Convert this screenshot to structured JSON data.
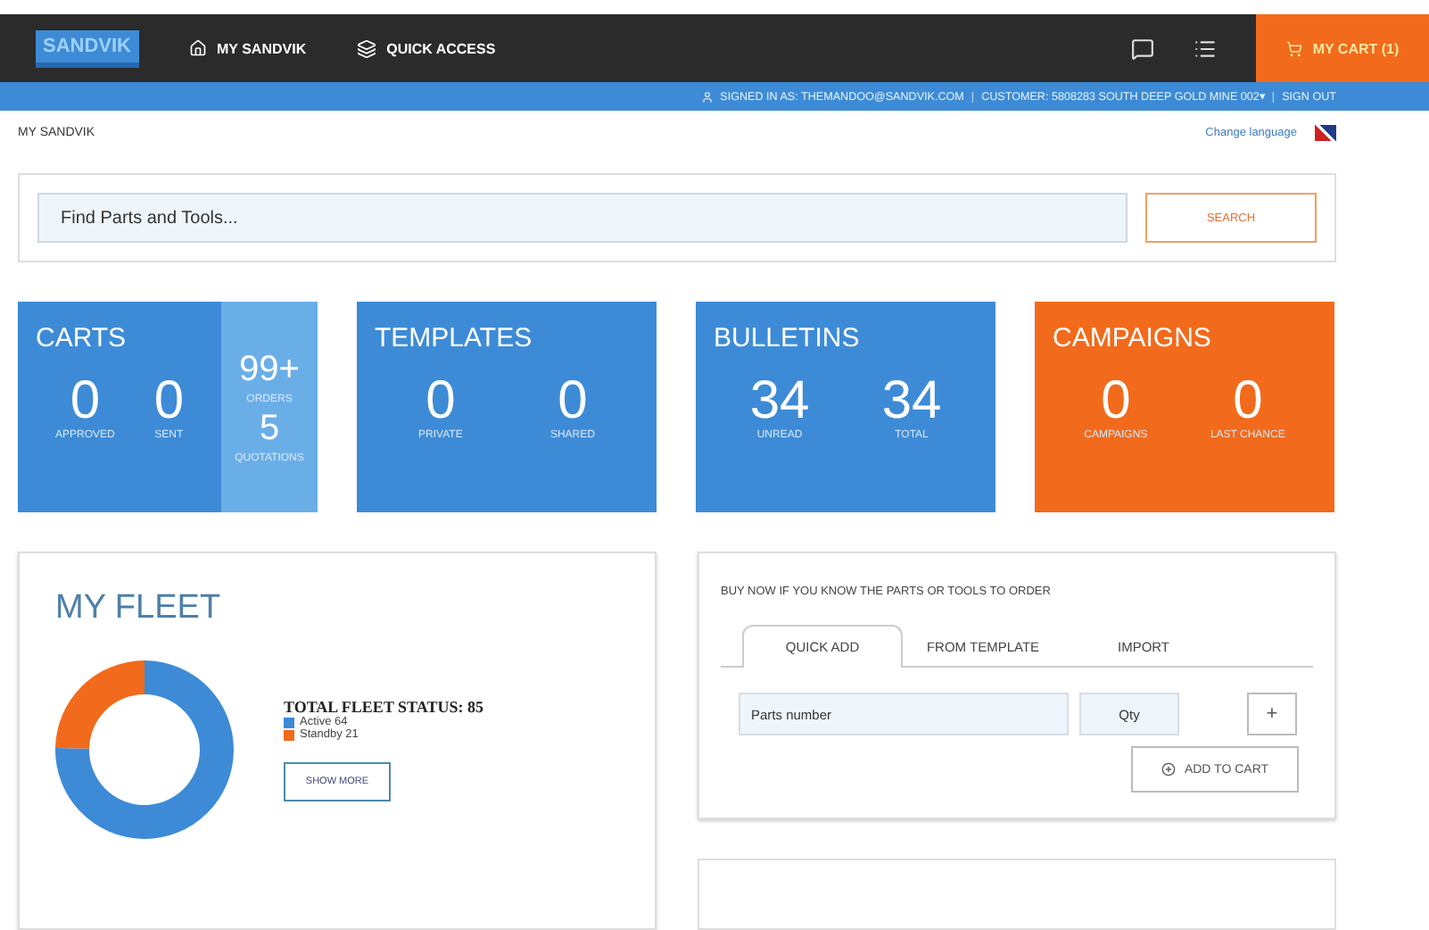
{
  "header": {
    "logo": "SANDVIK",
    "nav": [
      {
        "label": "MY SANDVIK",
        "kind": "home"
      },
      {
        "label": "QUICK ACCESS",
        "kind": "access"
      }
    ],
    "cart": "MY CART (1)"
  },
  "account_bar": {
    "signed_in": "SIGNED IN AS: THEMANDOO@SANDVIK.COM",
    "customer": "CUSTOMER: 5808283 SOUTH DEEP GOLD MINE 002▾",
    "sign_out": "SIGN OUT",
    "separator": "|"
  },
  "breadcrumb": "MY SANDVIK",
  "change_language": "Change language",
  "search": {
    "placeholder": "Find Parts and Tools...",
    "button": "SEARCH"
  },
  "tiles": [
    {
      "title": "CARTS",
      "color": "#3d8bd6",
      "stats": [
        {
          "value": "0",
          "label": "APPROVED"
        },
        {
          "value": "0",
          "label": "SENT"
        }
      ],
      "side": [
        {
          "value": "99+",
          "label": "ORDERS"
        },
        {
          "value": "5",
          "label": "QUOTATIONS"
        }
      ]
    },
    {
      "title": "TEMPLATES",
      "color": "#3d8bd6",
      "stats": [
        {
          "value": "0",
          "label": "PRIVATE"
        },
        {
          "value": "0",
          "label": "SHARED"
        }
      ]
    },
    {
      "title": "BULLETINS",
      "color": "#3d8bd6",
      "stats": [
        {
          "value": "34",
          "label": "UNREAD"
        },
        {
          "value": "34",
          "label": "TOTAL"
        }
      ]
    },
    {
      "title": "CAMPAIGNS",
      "color": "#f26a1b",
      "stats": [
        {
          "value": "0",
          "label": "CAMPAIGNS"
        },
        {
          "value": "0",
          "label": "LAST CHANCE"
        }
      ]
    }
  ],
  "fleet": {
    "title": "MY FLEET",
    "status": "TOTAL FLEET STATUS: 85",
    "legend": [
      {
        "label": "Active 64",
        "color": "#3d8bd6"
      },
      {
        "label": "Standby 21",
        "color": "#f26a1b"
      }
    ],
    "button": "SHOW MORE",
    "chart_data": {
      "type": "donut",
      "series": [
        {
          "values": [
            75.3,
            24.7
          ]
        }
      ]
    }
  },
  "buy": {
    "heading": "BUY NOW IF YOU KNOW THE PARTS OR TOOLS TO ORDER",
    "tabs": [
      {
        "label": "QUICK ADD",
        "selected": true
      },
      {
        "label": "FROM TEMPLATE",
        "selected": false
      },
      {
        "label": "IMPORT",
        "selected": false
      }
    ],
    "part_placeholder": "Parts number",
    "qty_placeholder": "Qty",
    "add_button": "+",
    "cart_button": "ADD TO CART"
  }
}
